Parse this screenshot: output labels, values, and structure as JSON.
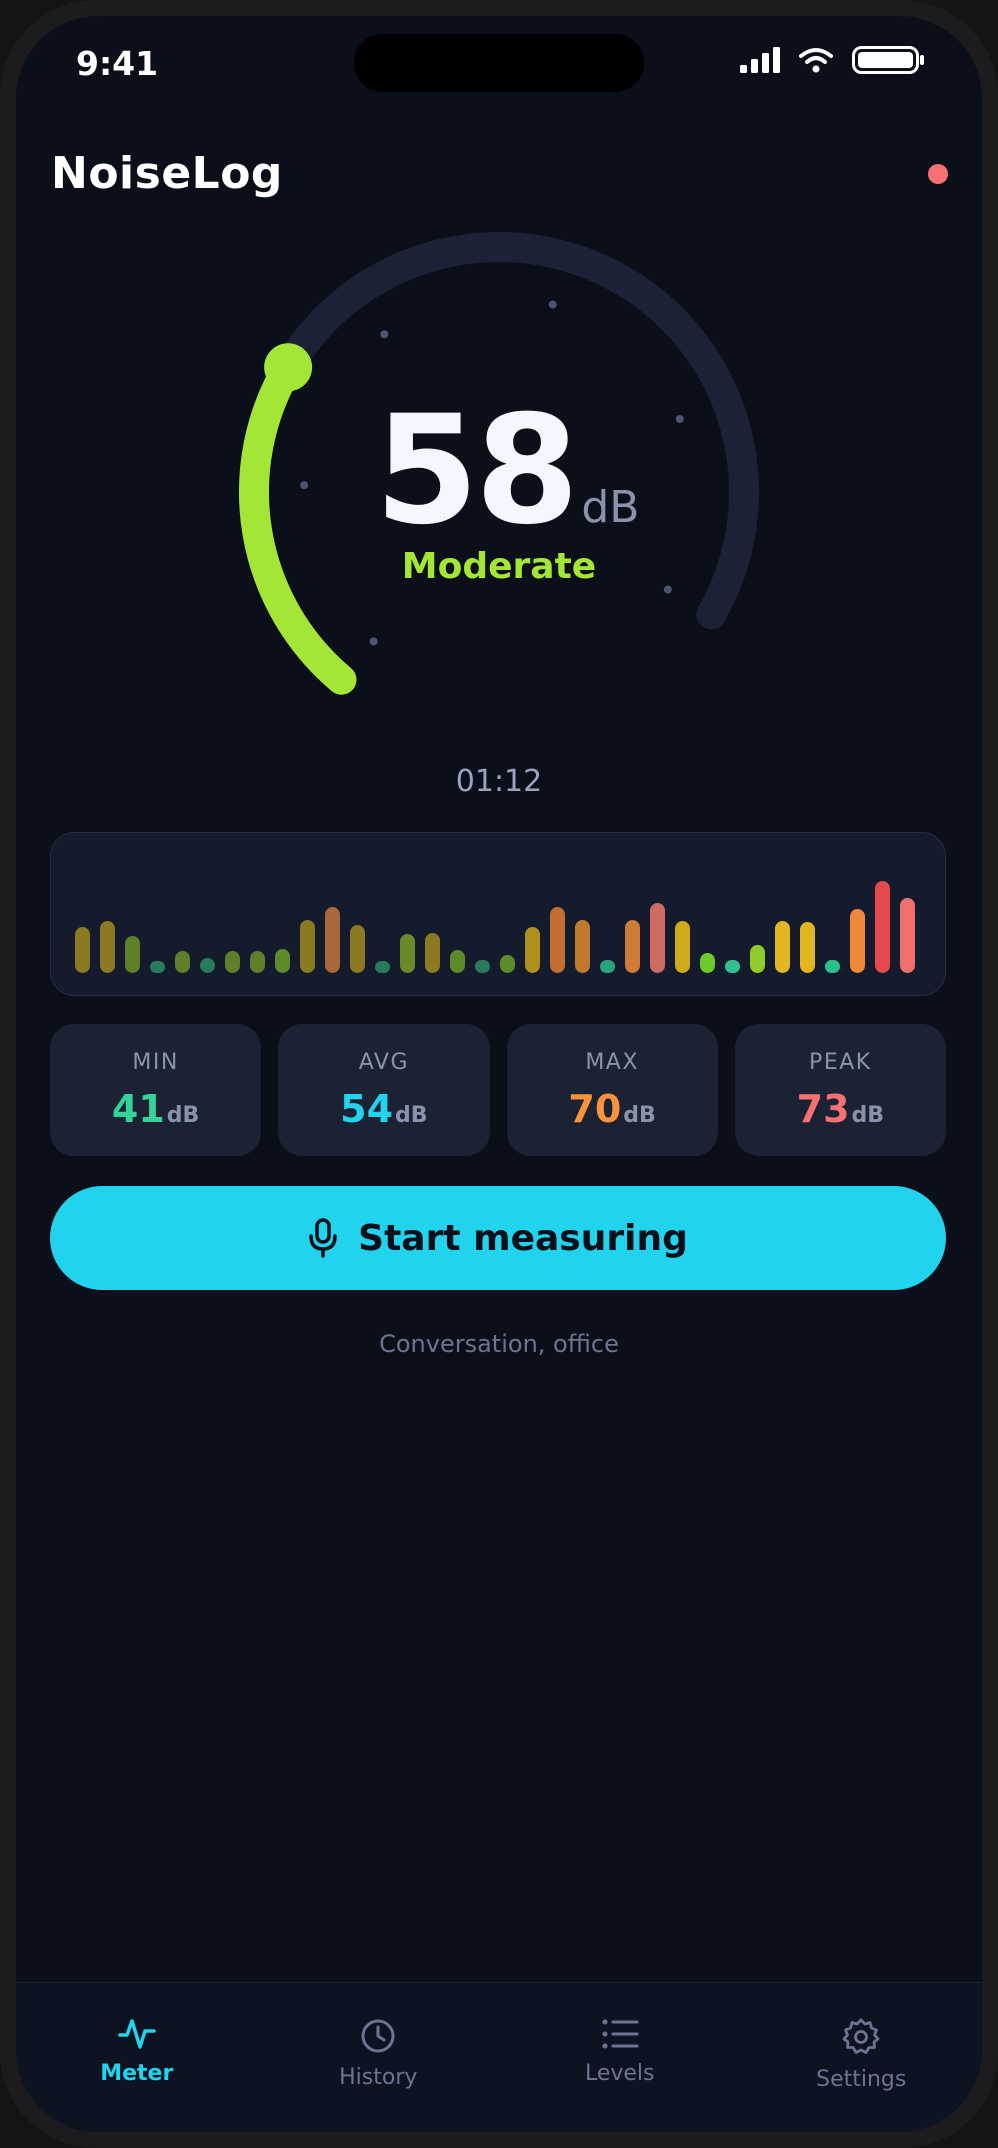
{
  "status": {
    "time": "9:41"
  },
  "app": {
    "title": "NoiseLog"
  },
  "meter": {
    "value": "58",
    "unit": "dB",
    "label": "Moderate",
    "timer": "01:12",
    "level_fraction": 0.31,
    "colors": {
      "active_arc": "#a3e635",
      "track": "#1b2236"
    }
  },
  "spectrum": {
    "levels": [
      [
        0.5,
        "#8b7a22"
      ],
      [
        0.56,
        "#8b7a22"
      ],
      [
        0.4,
        "#5f7f2a"
      ],
      [
        0.12,
        "#277a5a"
      ],
      [
        0.24,
        "#5f7f2a"
      ],
      [
        0.16,
        "#277a5a"
      ],
      [
        0.24,
        "#5f7f2a"
      ],
      [
        0.24,
        "#5f7f2a"
      ],
      [
        0.26,
        "#5f8a2a"
      ],
      [
        0.58,
        "#8b7a22"
      ],
      [
        0.72,
        "#a8683a"
      ],
      [
        0.52,
        "#8b7a22"
      ],
      [
        0.12,
        "#277a5a"
      ],
      [
        0.42,
        "#6a8a2a"
      ],
      [
        0.44,
        "#8b7a22"
      ],
      [
        0.25,
        "#5f8a2a"
      ],
      [
        0.14,
        "#277a5a"
      ],
      [
        0.2,
        "#5f8a2a"
      ],
      [
        0.5,
        "#b0901c"
      ],
      [
        0.72,
        "#c06e34"
      ],
      [
        0.58,
        "#c07a30"
      ],
      [
        0.14,
        "#2aa37a"
      ],
      [
        0.58,
        "#d07a38"
      ],
      [
        0.76,
        "#d06a64"
      ],
      [
        0.56,
        "#d0aa18"
      ],
      [
        0.22,
        "#6acb2a"
      ],
      [
        0.14,
        "#34c08a"
      ],
      [
        0.3,
        "#8fcb2a"
      ],
      [
        0.56,
        "#e3b520"
      ],
      [
        0.55,
        "#e3b520"
      ],
      [
        0.14,
        "#2ac08a"
      ],
      [
        0.7,
        "#f0883a"
      ],
      [
        1.0,
        "#e5484d"
      ],
      [
        0.82,
        "#f07070"
      ]
    ]
  },
  "stats": [
    {
      "label": "MIN",
      "value": "41",
      "unit": "dB",
      "color": "#34d399"
    },
    {
      "label": "AVG",
      "value": "54",
      "unit": "dB",
      "color": "#22d3ee"
    },
    {
      "label": "MAX",
      "value": "70",
      "unit": "dB",
      "color": "#fb923c"
    },
    {
      "label": "PEAK",
      "value": "73",
      "unit": "dB",
      "color": "#f87171"
    }
  ],
  "action": {
    "start_label": "Start measuring",
    "hint": "Conversation, office"
  },
  "tabs": [
    {
      "label": "Meter",
      "icon": "pulse-icon",
      "active": true
    },
    {
      "label": "History",
      "icon": "clock-icon",
      "active": false
    },
    {
      "label": "Levels",
      "icon": "list-icon",
      "active": false
    },
    {
      "label": "Settings",
      "icon": "gear-icon",
      "active": false
    }
  ],
  "colors": {
    "accent": "#22d3ee",
    "background": "#0b0f19",
    "recording": "#f87171"
  }
}
